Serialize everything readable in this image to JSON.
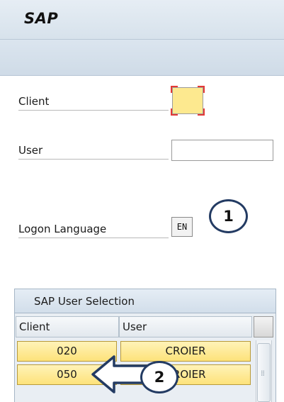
{
  "window": {
    "title": "SAP"
  },
  "logon_form": {
    "client_label": "Client",
    "client_value": "",
    "user_label": "User",
    "user_value": "",
    "language_label": "Logon Language",
    "language_value": "EN"
  },
  "callouts": [
    "1",
    "2"
  ],
  "user_selection": {
    "title": "SAP User Selection",
    "columns": [
      "Client",
      "User"
    ],
    "rows": [
      {
        "client": "020",
        "user": "CROIER"
      },
      {
        "client": "050",
        "user": "CROIER"
      }
    ]
  },
  "colors": {
    "highlight_yellow": "#fde27a",
    "focus_red": "#e53935",
    "callout_navy": "#233b63"
  }
}
